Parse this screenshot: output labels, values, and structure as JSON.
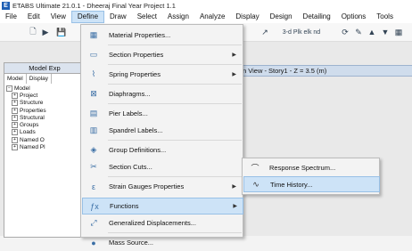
{
  "window": {
    "title": "ETABS Ultimate 21.0.1 - Dheeraj Final Year Project 1.1"
  },
  "menubar": [
    "File",
    "Edit",
    "View",
    "Define",
    "Draw",
    "Select",
    "Assign",
    "Analyze",
    "Display",
    "Design",
    "Detailing",
    "Options",
    "Tools"
  ],
  "active_menu": "Define",
  "toolbar": {
    "dropdown_text": "3-d  Plk  elk  nd"
  },
  "left_panel": {
    "title": "Model Exp",
    "tabs": [
      "Model",
      "Display"
    ],
    "tree": [
      "Model",
      "Project",
      "Structure",
      "Properties",
      "Structural",
      "Groups",
      "Loads",
      "Named O",
      "Named Pl"
    ]
  },
  "view_title": "n View - Story1 - Z = 3.5 (m)",
  "define_menu": [
    {
      "label": "Material Properties...",
      "icon": "material-icon",
      "submenu": false
    },
    {
      "label": "Section Properties",
      "icon": "section-icon",
      "submenu": true
    },
    {
      "label": "Spring Properties",
      "icon": "spring-icon",
      "submenu": true
    },
    {
      "label": "Diaphragms...",
      "icon": "diaphragm-icon",
      "submenu": false
    },
    {
      "label": "Pier Labels...",
      "icon": "pier-icon",
      "submenu": false
    },
    {
      "label": "Spandrel Labels...",
      "icon": "spandrel-icon",
      "submenu": false
    },
    {
      "label": "Group Definitions...",
      "icon": "group-icon",
      "submenu": false
    },
    {
      "label": "Section Cuts...",
      "icon": "section-cut-icon",
      "submenu": false
    },
    {
      "label": "Strain Gauges Properties",
      "icon": "strain-gauge-icon",
      "submenu": true
    },
    {
      "label": "Functions",
      "icon": "functions-icon",
      "submenu": true
    },
    {
      "label": "Generalized Displacements...",
      "icon": "displacement-icon",
      "submenu": false
    },
    {
      "label": "Mass Source...",
      "icon": "mass-icon",
      "submenu": false
    }
  ],
  "highlighted_item": "Functions",
  "functions_submenu": [
    {
      "label": "Response Spectrum...",
      "icon": "response-spectrum-icon"
    },
    {
      "label": "Time History...",
      "icon": "time-history-icon"
    }
  ],
  "highlighted_subitem": "Time History...",
  "colors": {
    "highlight": "#cde3f7",
    "highlight_border": "#98c0e6",
    "menu_bg": "#f3f3f3"
  }
}
